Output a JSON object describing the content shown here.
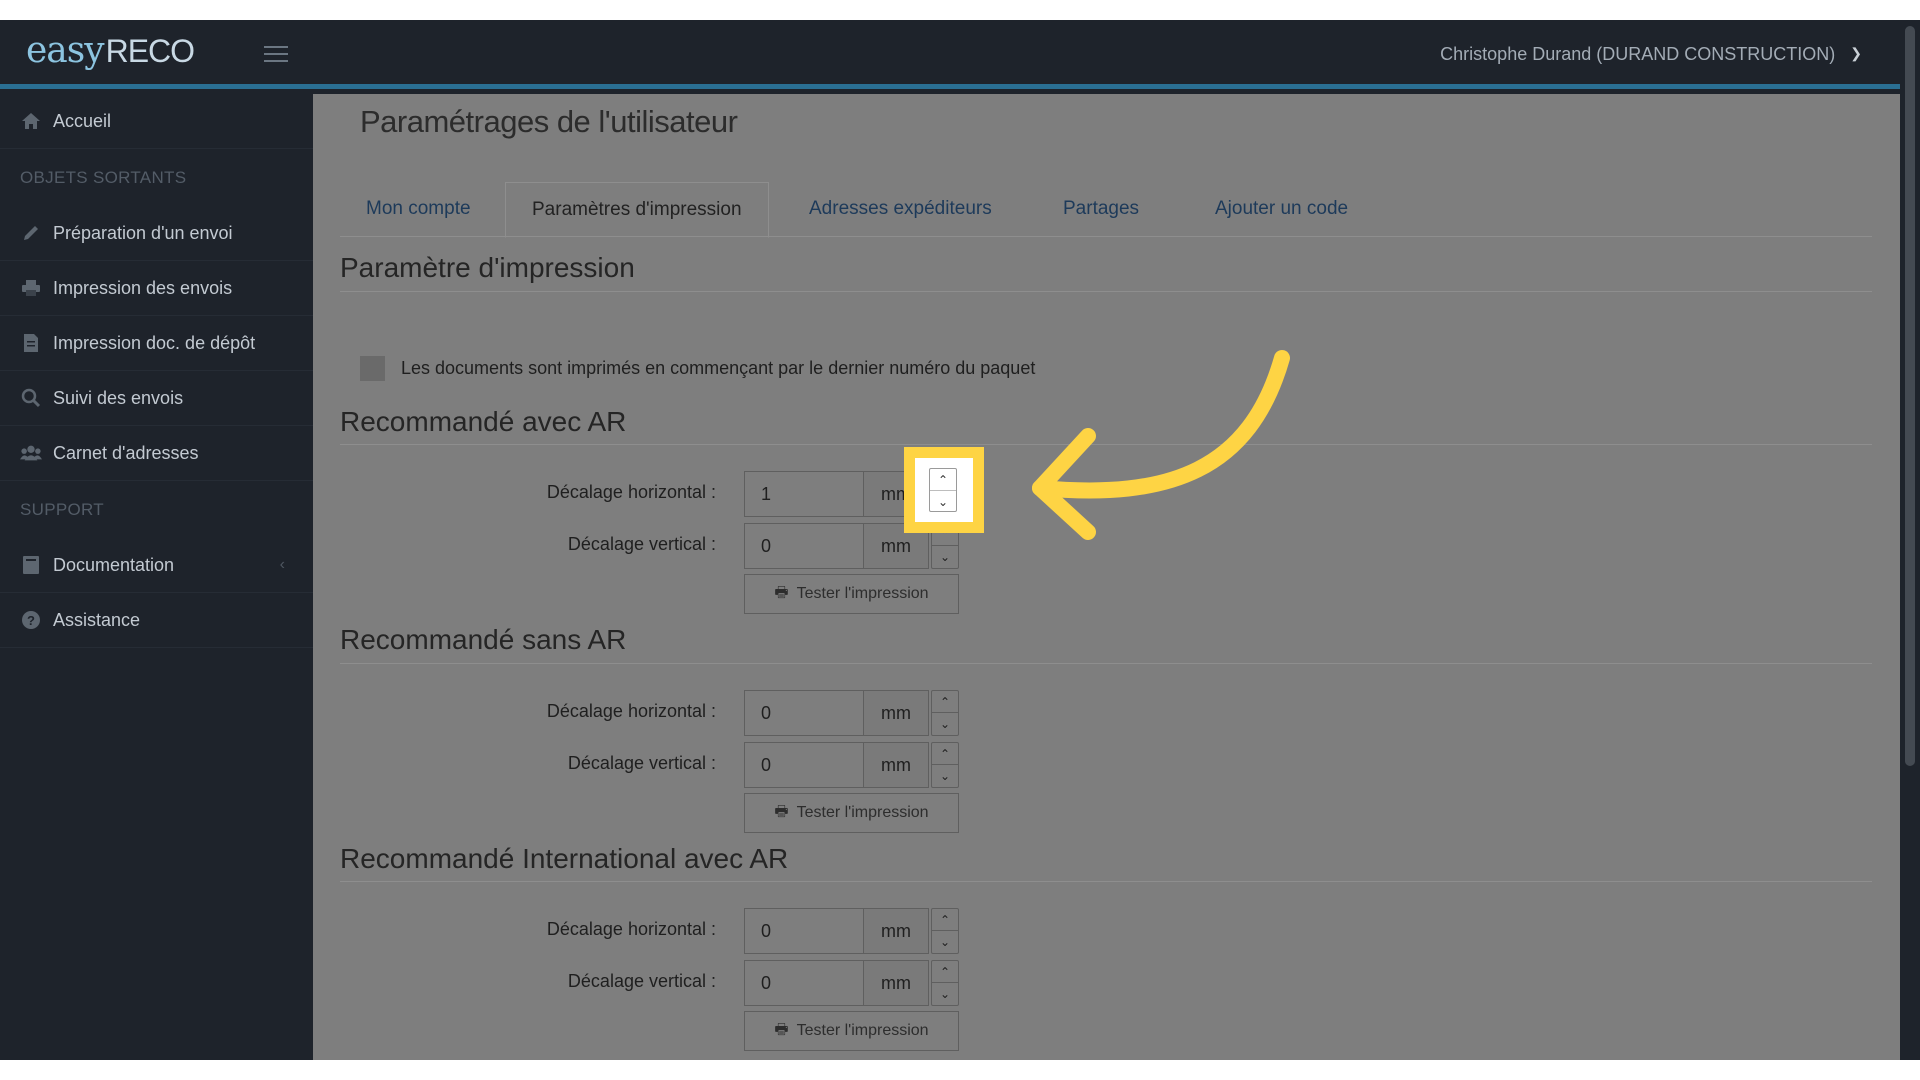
{
  "app": {
    "logo_easy": "easy",
    "logo_reco": "RECO",
    "user_menu_label": "Christophe Durand (DURAND CONSTRUCTION)"
  },
  "sidebar": {
    "items": [
      {
        "label": "Accueil",
        "icon": "home-icon"
      },
      {
        "label": "Préparation d'un envoi",
        "icon": "pencil-icon"
      },
      {
        "label": "Impression des envois",
        "icon": "printer-icon"
      },
      {
        "label": "Impression doc. de dépôt",
        "icon": "document-icon"
      },
      {
        "label": "Suivi des envois",
        "icon": "search-icon"
      },
      {
        "label": "Carnet d'adresses",
        "icon": "users-icon"
      },
      {
        "label": "Documentation",
        "icon": "book-icon"
      },
      {
        "label": "Assistance",
        "icon": "question-icon"
      }
    ],
    "headings": [
      "OBJETS SORTANTS",
      "SUPPORT"
    ]
  },
  "main": {
    "page_title": "Paramétrages de l'utilisateur",
    "tabs": [
      {
        "label": "Mon compte",
        "active": false
      },
      {
        "label": "Paramètres d'impression",
        "active": true
      },
      {
        "label": "Adresses expéditeurs",
        "active": false
      },
      {
        "label": "Partages",
        "active": false
      },
      {
        "label": "Ajouter un code",
        "active": false
      }
    ],
    "print_section_title": "Paramètre d'impression",
    "reverse_order_label": "Les documents sont imprimés en commençant par le dernier numéro du paquet",
    "reverse_order_checked": false,
    "horizontal_label": "Décalage horizontal :",
    "vertical_label": "Décalage vertical :",
    "unit": "mm",
    "test_button_label": "Tester l'impression",
    "sections": [
      {
        "title": "Recommandé avec AR",
        "horizontal": "1",
        "vertical": "0"
      },
      {
        "title": "Recommandé sans AR",
        "horizontal": "0",
        "vertical": "0"
      },
      {
        "title": "Recommandé International avec AR",
        "horizontal": "0",
        "vertical": "0"
      }
    ]
  },
  "colors": {
    "sidebar_bg": "#1e232b",
    "header_accent": "#2a6f93",
    "overlay_dim": "#7e7e7e",
    "highlight": "#fed444",
    "tab_link": "#1d3a5a"
  }
}
